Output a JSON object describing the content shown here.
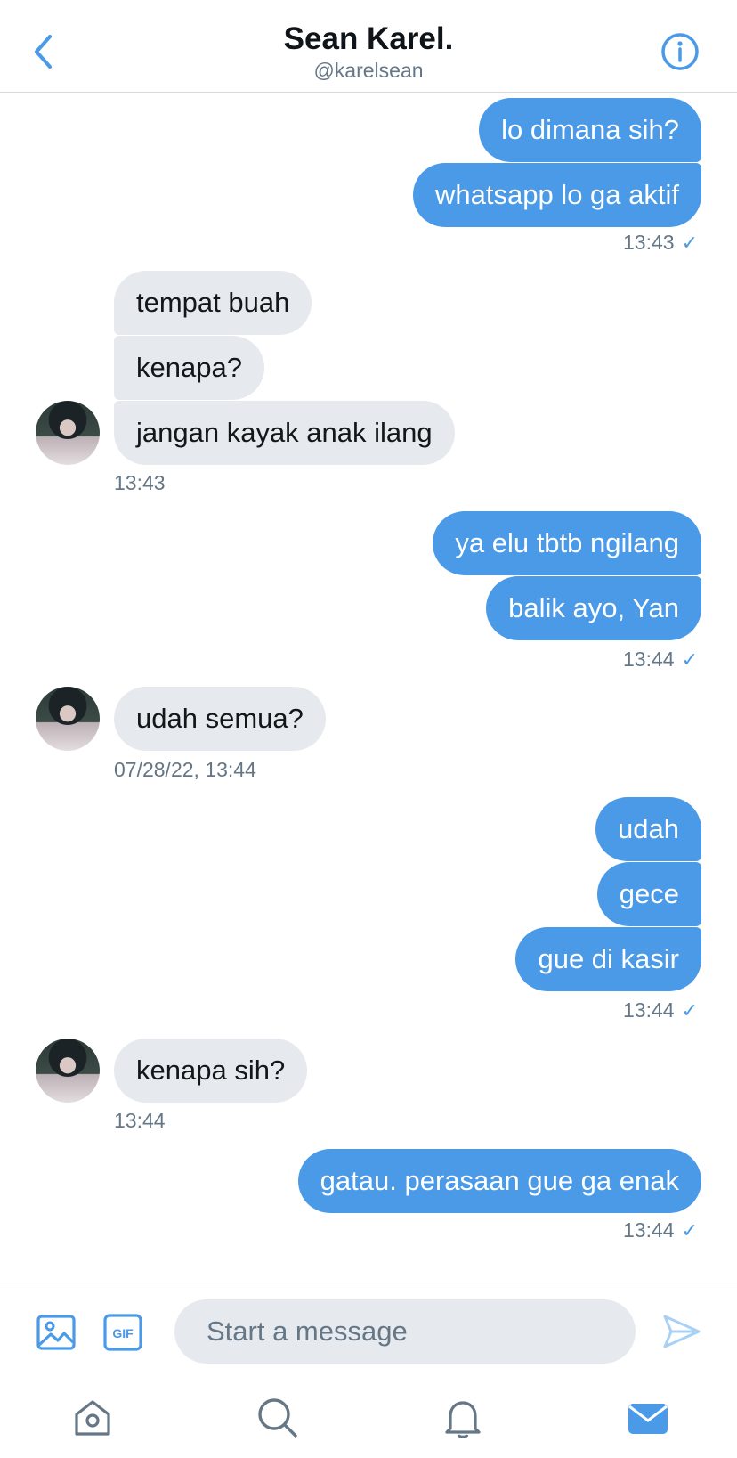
{
  "header": {
    "title": "Sean Karel.",
    "handle": "@karelsean"
  },
  "icons": {
    "back": "chevron-left-icon",
    "info": "info-icon",
    "media": "image-icon",
    "gif": "gif-icon",
    "send": "send-icon",
    "home": "home-icon",
    "search": "search-icon",
    "notifications": "bell-icon",
    "messages": "mail-icon"
  },
  "gif_label": "GIF",
  "messages": [
    {
      "dir": "out",
      "text": "lo dimana sih?"
    },
    {
      "dir": "out",
      "text": "whatsapp lo ga aktif"
    },
    {
      "time": "13:43",
      "dir": "out",
      "read": true
    },
    {
      "dir": "in",
      "text": "tempat buah"
    },
    {
      "dir": "in",
      "text": "kenapa?"
    },
    {
      "dir": "in",
      "text": "jangan kayak anak ilang"
    },
    {
      "time": "13:43",
      "dir": "in"
    },
    {
      "dir": "out",
      "text": "ya elu tbtb ngilang"
    },
    {
      "dir": "out",
      "text": "balik ayo, Yan"
    },
    {
      "time": "13:44",
      "dir": "out",
      "read": true
    },
    {
      "dir": "in",
      "text": "udah semua?"
    },
    {
      "time": "07/28/22, 13:44",
      "dir": "in"
    },
    {
      "dir": "out",
      "text": "udah"
    },
    {
      "dir": "out",
      "text": "gece"
    },
    {
      "dir": "out",
      "text": "gue di kasir"
    },
    {
      "time": "13:44",
      "dir": "out",
      "read": true
    },
    {
      "dir": "in",
      "text": "kenapa sih?"
    },
    {
      "time": "13:44",
      "dir": "in"
    },
    {
      "dir": "out",
      "text": "gatau. perasaan gue ga enak"
    },
    {
      "time": "13:44",
      "dir": "out",
      "read": true
    }
  ],
  "composer": {
    "placeholder": "Start a message"
  },
  "colors": {
    "accent": "#4a9ae8",
    "incoming_bubble": "#e6e9ed",
    "secondary_text": "#657786"
  }
}
